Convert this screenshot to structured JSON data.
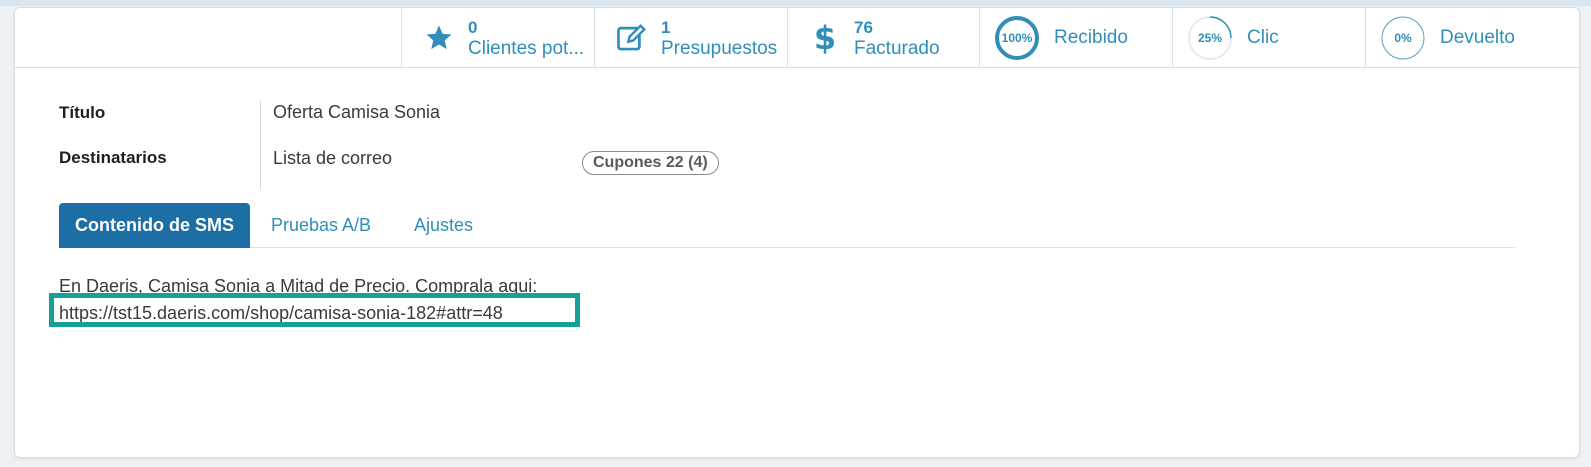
{
  "stats": [
    {
      "value": "0",
      "label": "Clientes pot...",
      "icon": "star-icon"
    },
    {
      "value": "1",
      "label": "Presupuestos",
      "icon": "edit-icon"
    },
    {
      "value": "76",
      "label": "Facturado",
      "icon": "dollar-icon"
    }
  ],
  "gauges": [
    {
      "percent_text": "100%",
      "label": "Recibido",
      "percent": 100
    },
    {
      "percent_text": "25%",
      "label": "Clic",
      "percent": 25
    },
    {
      "percent_text": "0%",
      "label": "Devuelto",
      "percent": 0
    }
  ],
  "form": {
    "title_label": "Título",
    "title_value": "Oferta Camisa Sonia",
    "recipients_label": "Destinatarios",
    "recipients_value": "Lista de correo",
    "recipients_tag": "Cupones 22 (4)"
  },
  "tabs": [
    {
      "label": "Contenido de SMS",
      "active": true
    },
    {
      "label": "Pruebas A/B",
      "active": false
    },
    {
      "label": "Ajustes",
      "active": false
    }
  ],
  "sms": {
    "line1": "En Daeris, Camisa Sonia a Mitad de Precio. Comprala aqui:",
    "link": "https://tst15.daeris.com/shop/camisa-sonia-182#attr=48"
  },
  "colors": {
    "accent": "#2f8fb8",
    "tab_active": "#1c6ea4",
    "highlight": "#16a09a"
  }
}
